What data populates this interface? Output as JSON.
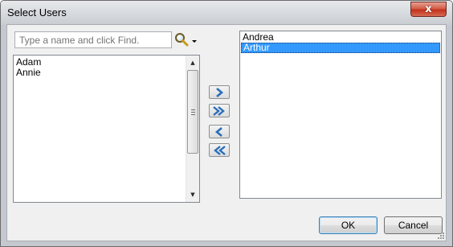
{
  "window": {
    "title": "Select Users",
    "close_glyph": "x"
  },
  "search": {
    "placeholder": "Type a name and click Find.",
    "value": ""
  },
  "find_button": {
    "icon": "magnifier-icon",
    "dropdown_icon": "dropdown-arrow-icon"
  },
  "available_users": [
    "Adam",
    "Annie"
  ],
  "selected_users": [
    {
      "name": "Andrea",
      "selected": false
    },
    {
      "name": "Arthur",
      "selected": true
    }
  ],
  "move_buttons": {
    "add": "chevron-right-icon",
    "add_all": "double-chevron-right-icon",
    "remove": "chevron-left-icon",
    "remove_all": "double-chevron-left-icon"
  },
  "buttons": {
    "ok": "OK",
    "cancel": "Cancel"
  },
  "colors": {
    "selection": "#3399ff",
    "arrow": "#2a6fb8",
    "close": "#c3321c"
  }
}
